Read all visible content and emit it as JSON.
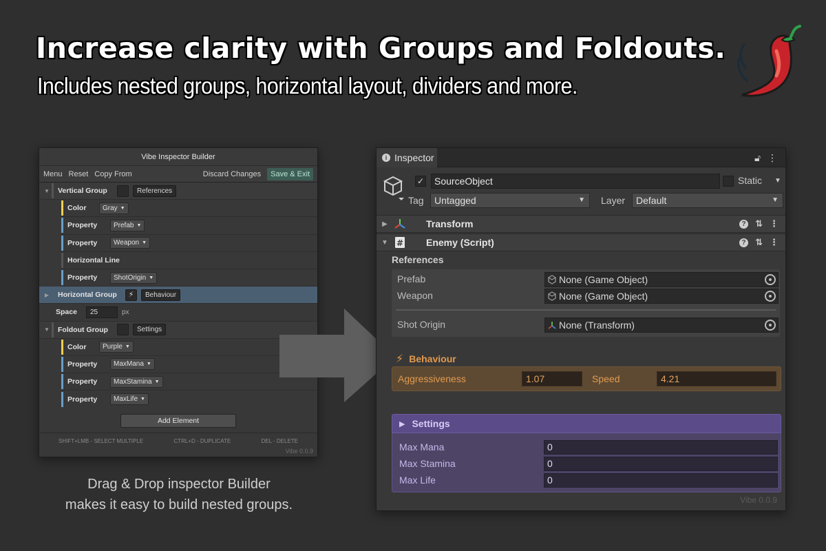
{
  "headline": "Increase clarity with Groups and Foldouts.",
  "subheadline": "Includes nested groups, horizontal layout, dividers and more.",
  "builder": {
    "title": "Vibe Inspector Builder",
    "toolbar": {
      "menu": "Menu",
      "reset": "Reset",
      "copy_from": "Copy From",
      "discard": "Discard Changes",
      "save_exit": "Save & Exit"
    },
    "rows": {
      "vertical_group": {
        "label": "Vertical Group",
        "chip": "References"
      },
      "color1": {
        "label": "Color",
        "value": "Gray"
      },
      "prop_prefab": {
        "label": "Property",
        "value": "Prefab"
      },
      "prop_weapon": {
        "label": "Property",
        "value": "Weapon"
      },
      "horizontal_line": {
        "label": "Horizontal Line"
      },
      "prop_shot": {
        "label": "Property",
        "value": "ShotOrigin"
      },
      "horizontal_group": {
        "label": "Horizontal Group",
        "chip": "Behaviour"
      },
      "space": {
        "label": "Space",
        "value": "25",
        "unit": "px"
      },
      "foldout_group": {
        "label": "Foldout Group",
        "chip": "Settings"
      },
      "color2": {
        "label": "Color",
        "value": "Purple"
      },
      "prop_mana": {
        "label": "Property",
        "value": "MaxMana"
      },
      "prop_stamina": {
        "label": "Property",
        "value": "MaxStamina"
      },
      "prop_life": {
        "label": "Property",
        "value": "MaxLife"
      }
    },
    "add_element": "Add Element",
    "footer": {
      "hint1": "SHIFT+LMB - SELECT MULTIPLE",
      "hint2": "CTRL+D - DUPLICATE",
      "hint3": "DEL - DELETE"
    },
    "version": "Vibe 0.0.9",
    "colors": {
      "gray_bar": "#f0d050",
      "property_bar": "#6a9ec8",
      "selected_row": "#4b5f73"
    }
  },
  "caption": {
    "line1": "Drag & Drop inspector Builder",
    "line2": "makes it easy to build nested groups."
  },
  "inspector": {
    "tab": "Inspector",
    "object_name": "SourceObject",
    "static_label": "Static",
    "tag_label": "Tag",
    "tag_value": "Untagged",
    "layer_label": "Layer",
    "layer_value": "Default",
    "transform": "Transform",
    "script": "Enemy (Script)",
    "references": {
      "title": "References",
      "prefab_label": "Prefab",
      "prefab_value": "None (Game Object)",
      "weapon_label": "Weapon",
      "weapon_value": "None (Game Object)",
      "shot_label": "Shot Origin",
      "shot_value": "None (Transform)"
    },
    "behaviour": {
      "title": "Behaviour",
      "aggr_label": "Aggressiveness",
      "aggr_value": "1.07",
      "speed_label": "Speed",
      "speed_value": "4.21",
      "accent": "#e39a4e"
    },
    "settings": {
      "title": "Settings",
      "mana_label": "Max Mana",
      "mana_value": "0",
      "stamina_label": "Max Stamina",
      "stamina_value": "0",
      "life_label": "Max Life",
      "life_value": "0",
      "accent": "#5b4b88"
    },
    "version": "Vibe 0.0.9"
  }
}
